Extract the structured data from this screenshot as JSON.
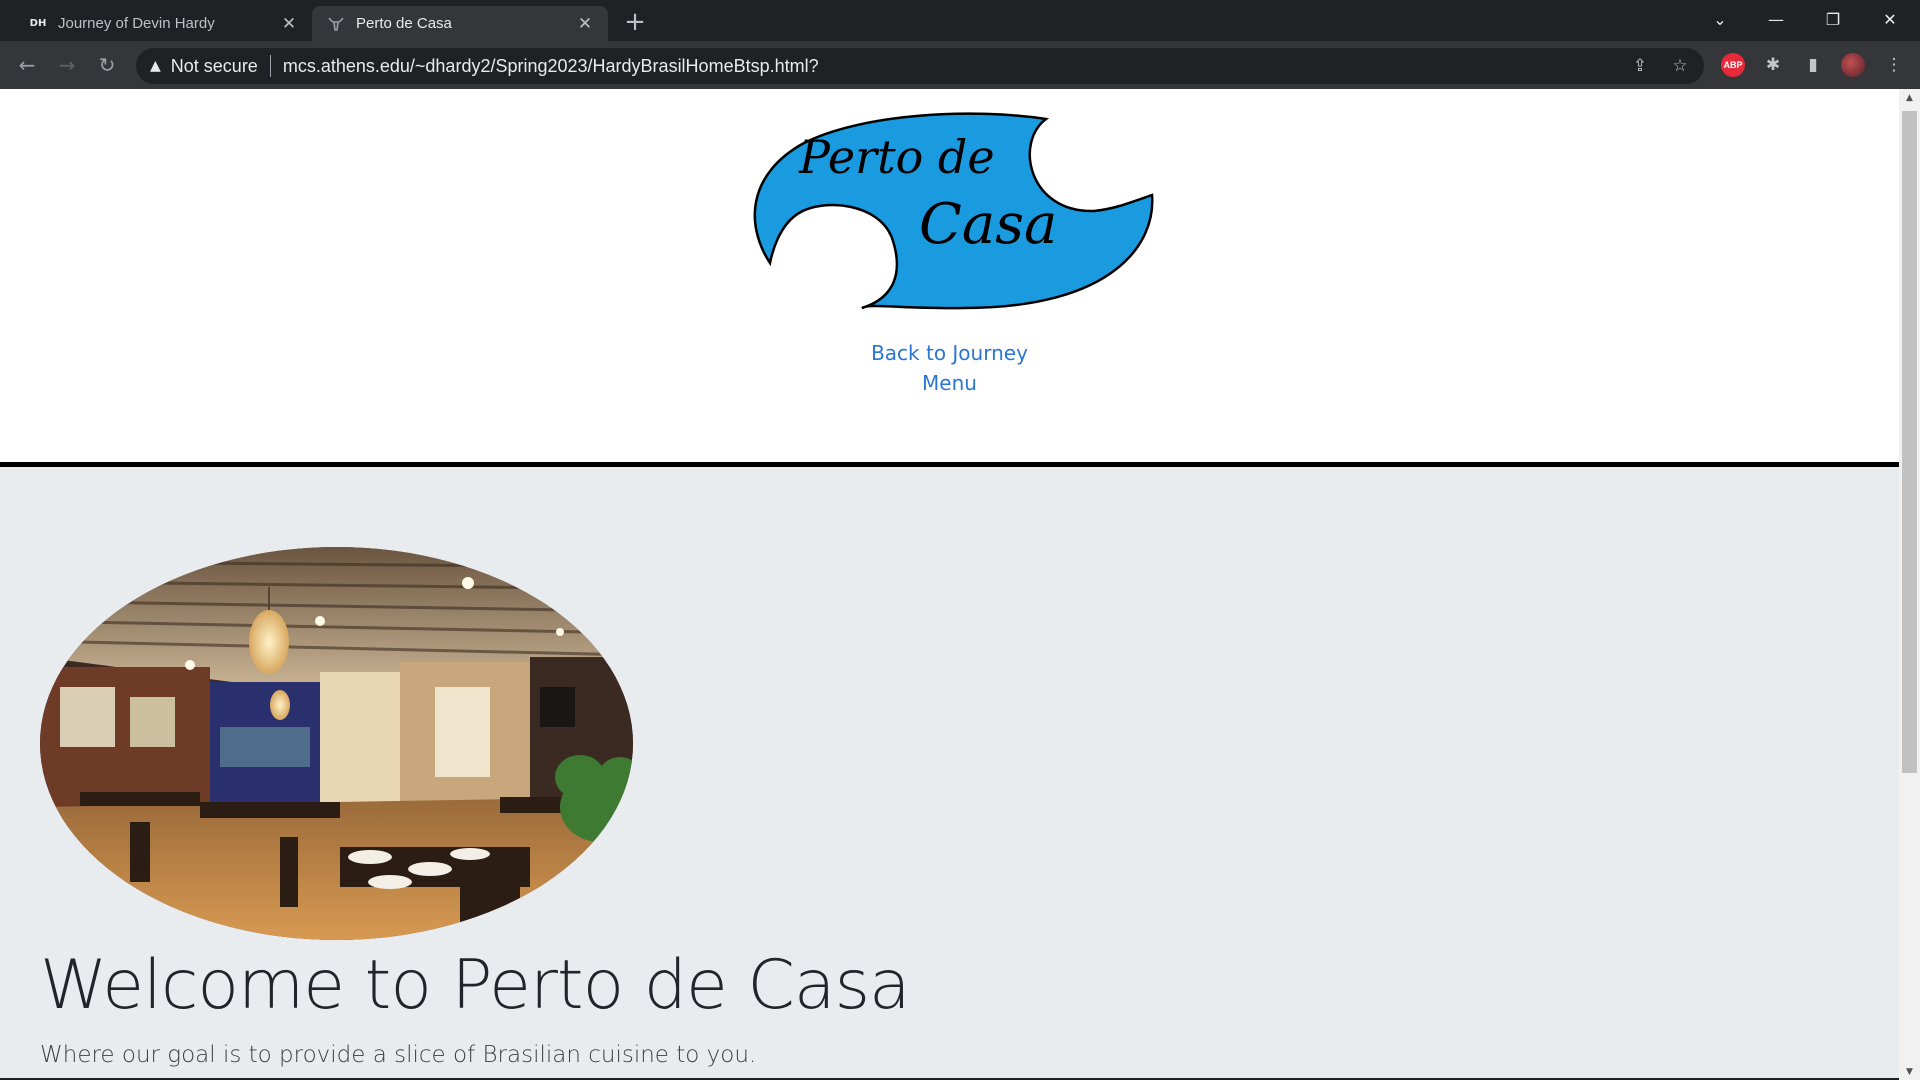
{
  "browser": {
    "tabs": [
      {
        "title": "Journey of Devin Hardy",
        "favicon": "DH",
        "active": false
      },
      {
        "title": "Perto de Casa",
        "favicon": "",
        "active": true
      }
    ],
    "security_label": "Not secure",
    "url": "mcs.athens.edu/~dhardy2/Spring2023/HardyBrasilHomeBtsp.html?",
    "extensions": [
      "share-icon",
      "bookmark-star-icon",
      "adblock-plus-icon",
      "extensions-puzzle-icon",
      "side-panel-icon",
      "profile-avatar",
      "kebab-menu-icon"
    ],
    "abp_label": "ABP"
  },
  "page": {
    "logo_text_line1": "Perto de",
    "logo_text_line2": "Casa",
    "logo_color": "#1a9be0",
    "nav": [
      {
        "label": "Back to Journey"
      },
      {
        "label": "Menu"
      }
    ],
    "link_color": "#2a76d2",
    "welcome_heading": "Welcome to Perto de Casa",
    "lead_text": "Where our goal is to provide a slice of Brasilian cuisine to you.",
    "jumbotron_bg": "#e9ecef"
  }
}
